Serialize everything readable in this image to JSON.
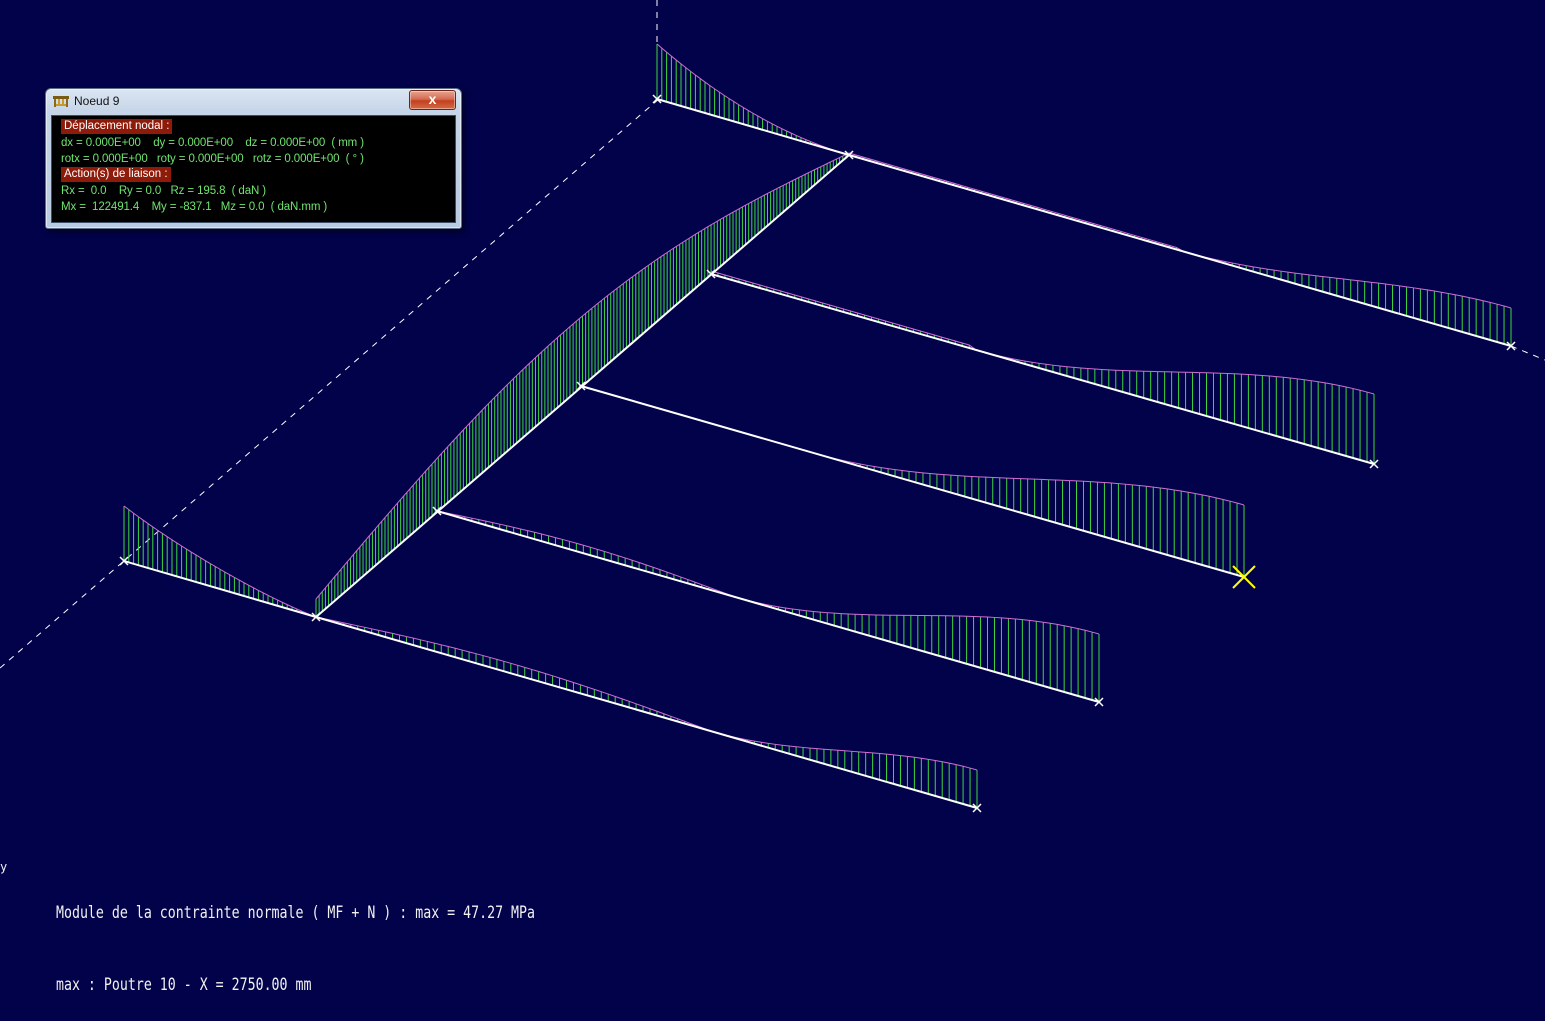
{
  "window": {
    "title": "Noeud 9",
    "close_label": "x",
    "sections": {
      "deplacement": {
        "header": "Déplacement nodal :",
        "line1": "dx = 0.000E+00    dy = 0.000E+00    dz = 0.000E+00  ( mm )",
        "line2": "rotx = 0.000E+00   roty = 0.000E+00   rotz = 0.000E+00  ( ° )"
      },
      "liaison": {
        "header": "Action(s) de liaison :",
        "line1": "Rx =  0.0    Ry = 0.0   Rz = 195.8  ( daN )",
        "line2": "Mx =  122491.4    My = -837.1   Mz = 0.0  ( daN.mm )"
      }
    }
  },
  "status": {
    "line1": "Module de la contrainte normale ( MF + N ) : max = 47.27 MPa",
    "line2": "max : Poutre 10 - X = 2750.00 mm"
  },
  "edge_label": "y",
  "colors": {
    "background": "#02024a",
    "beam": "#ffffff",
    "hatch": "#3ed83e",
    "envelope": "#d26cd2",
    "marker": "#ffff00",
    "axis": "#ffffff"
  },
  "icons": {
    "window": "structure-app-icon",
    "close": "close-icon",
    "node": "node-cross-icon",
    "selected_node": "selected-node-icon"
  }
}
